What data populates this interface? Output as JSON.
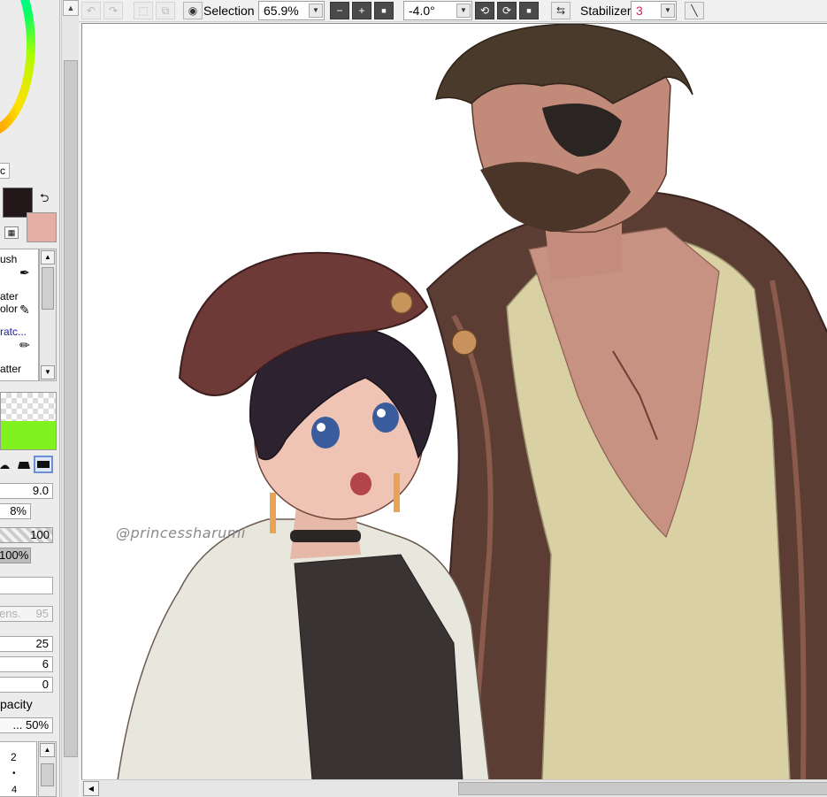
{
  "toolbar": {
    "selection_label": "Selection",
    "zoom_value": "65.9%",
    "zoom_out": "−",
    "zoom_in": "+",
    "zoom_reset": "■",
    "rotation_value": "-4.0°",
    "rotate_reset": "■",
    "stabilizer_label": "Stabilizer",
    "stabilizer_value": "3",
    "stabilizer_color": "#cc2266"
  },
  "left_panel": {
    "mode_label": "c",
    "tools": [
      {
        "label": "ush"
      },
      {
        "label": "ater"
      },
      {
        "label": "olor"
      },
      {
        "label": "ratc..."
      },
      {
        "label": "atter"
      }
    ],
    "scratch_color": "#1a1aa8",
    "brush_size": "9.0",
    "min_size": "8%",
    "density": "100",
    "opacity_value": "100%",
    "blending_placeholder": "",
    "persistence_label": "ens.",
    "persistence_value": "95",
    "blend": "25",
    "dilution": "6",
    "persistence": "0",
    "keep_opacity_label": "pacity",
    "keep_opacity_value": "... 50%",
    "size_presets": [
      "2",
      "•",
      "4"
    ]
  },
  "colors": {
    "foreground": "#231719",
    "background": "#e4aea4"
  },
  "canvas": {
    "watermark": "@princessharumi"
  }
}
